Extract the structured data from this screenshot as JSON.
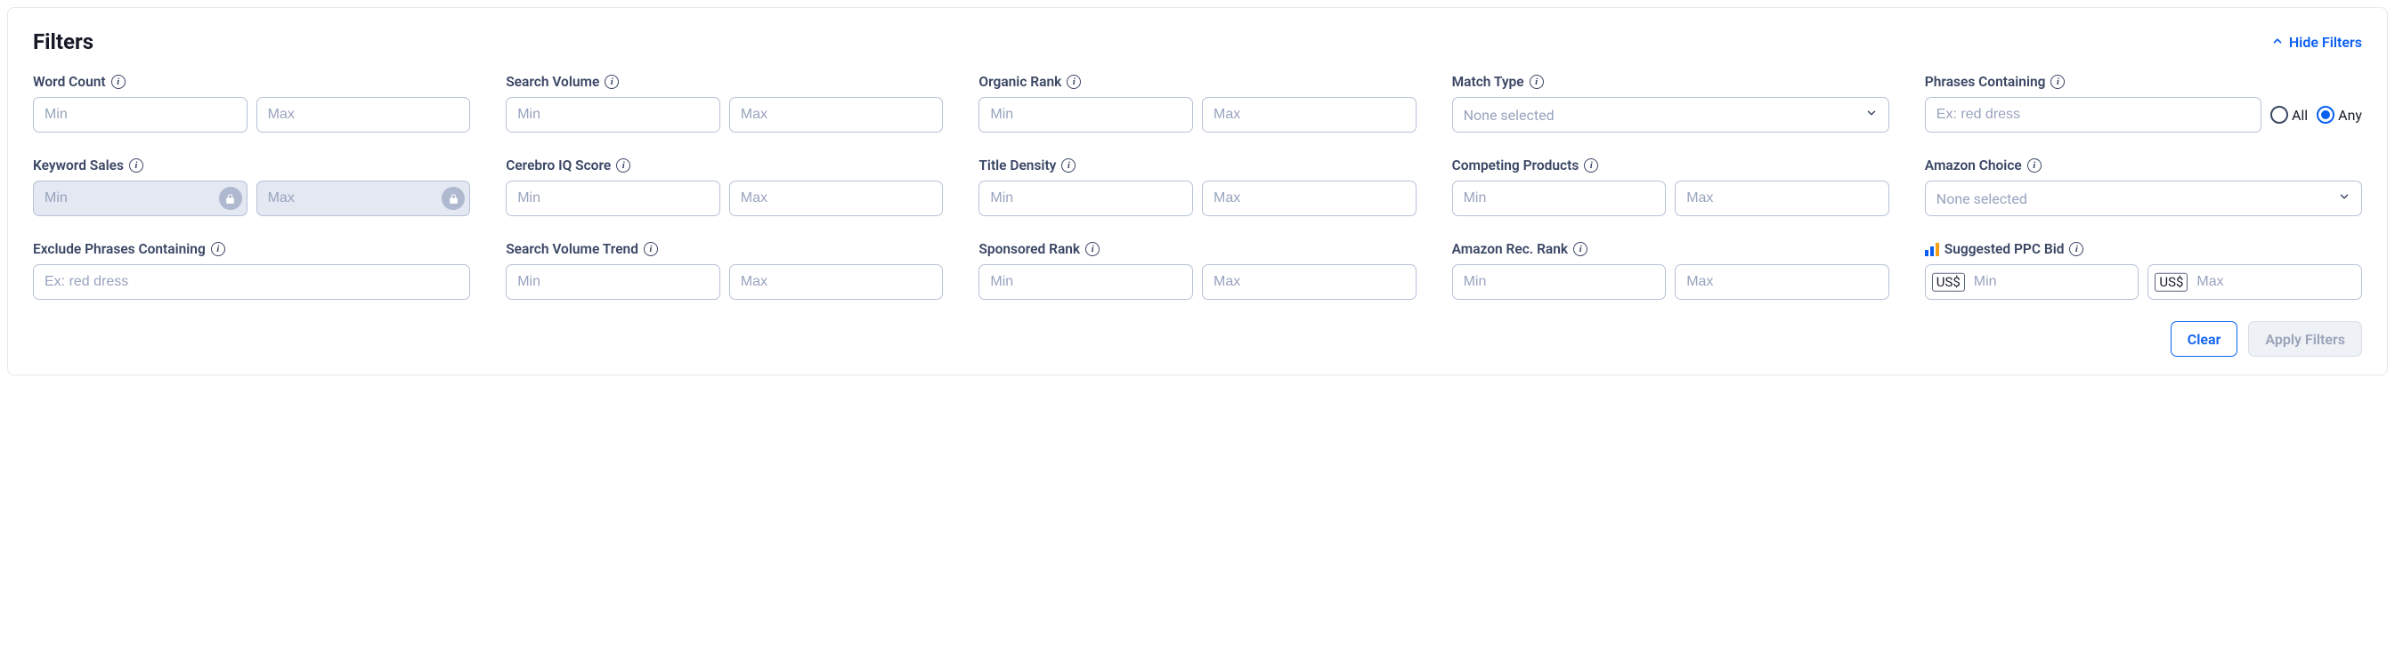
{
  "header": {
    "title": "Filters",
    "hide_label": "Hide Filters"
  },
  "placeholders": {
    "min": "Min",
    "max": "Max",
    "example": "Ex: red dress",
    "none_selected": "None selected"
  },
  "labels": {
    "word_count": "Word Count",
    "search_volume": "Search Volume",
    "organic_rank": "Organic Rank",
    "match_type": "Match Type",
    "phrases_containing": "Phrases Containing",
    "keyword_sales": "Keyword Sales",
    "cerebro_iq": "Cerebro IQ Score",
    "title_density": "Title Density",
    "competing_products": "Competing Products",
    "amazon_choice": "Amazon Choice",
    "exclude_phrases": "Exclude Phrases Containing",
    "sv_trend": "Search Volume Trend",
    "sponsored_rank": "Sponsored Rank",
    "amazon_rec_rank": "Amazon Rec. Rank",
    "suggested_ppc": "Suggested PPC Bid"
  },
  "phrase_mode": {
    "all": "All",
    "any": "Any",
    "selected": "any"
  },
  "ppc": {
    "currency": "US$"
  },
  "footer": {
    "clear": "Clear",
    "apply": "Apply Filters"
  }
}
